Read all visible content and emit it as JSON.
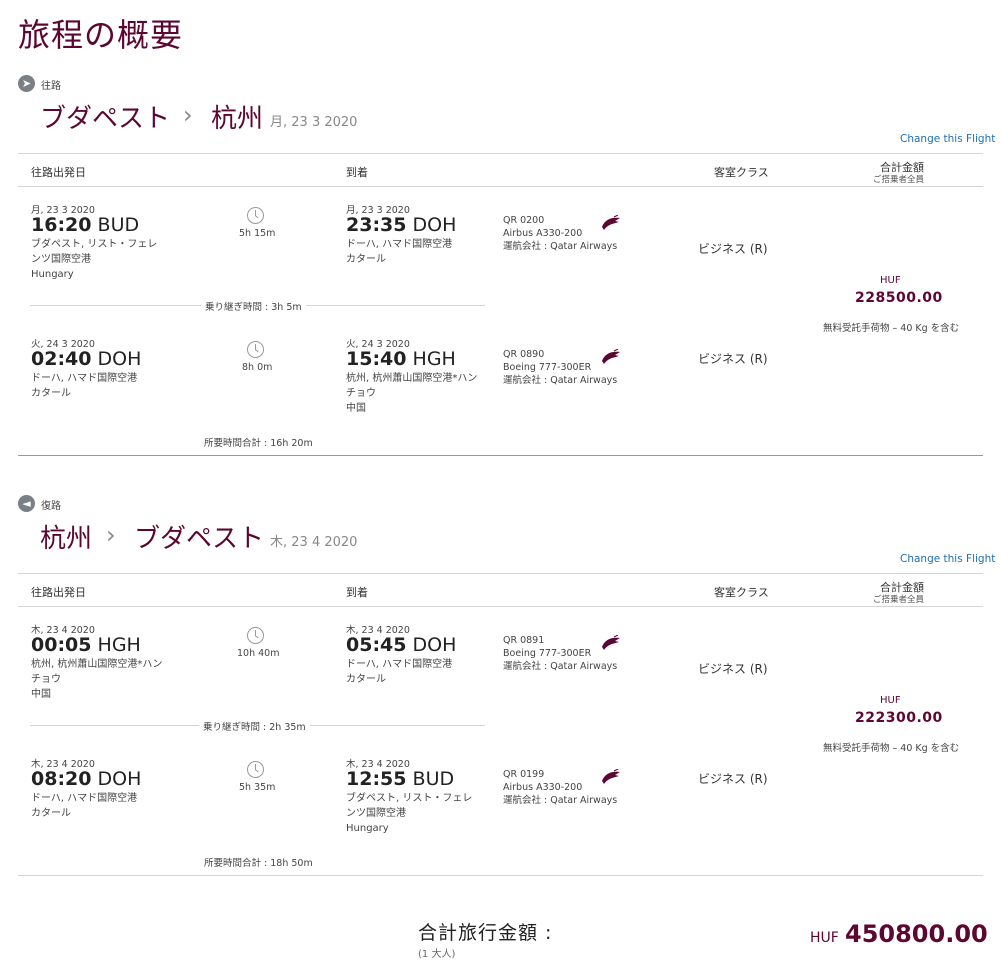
{
  "page_title": "旅程の概要",
  "headers": {
    "departure": "往路出発日",
    "arrival": "到着",
    "cabin": "客室クラス",
    "total": "合計金額",
    "total_sub": "ご搭乗者全員"
  },
  "change_link": "Change this Flight",
  "outbound": {
    "dir_label": "往路",
    "from": "ブダペスト",
    "to": "杭州",
    "date": "月, 23 3 2020",
    "segments": [
      {
        "dep_date": "月, 23 3 2020",
        "dep_time": "16:20",
        "dep_code": "BUD",
        "dep_airport_1": "ブダペスト, リスト・フェレ",
        "dep_airport_2": "ンツ国際空港",
        "dep_country": "Hungary",
        "duration": "5h 15m",
        "arr_date": "月, 23 3 2020",
        "arr_time": "23:35",
        "arr_code": "DOH",
        "arr_airport_1": "ドーハ, ハマド国際空港",
        "arr_airport_2": "カタール",
        "arr_country": "",
        "flight_no": "QR 0200",
        "aircraft": "Airbus A330-200",
        "operator": "運航会社 : Qatar Airways",
        "cabin": "ビジネス (R)"
      },
      {
        "dep_date": "火, 24 3 2020",
        "dep_time": "02:40",
        "dep_code": "DOH",
        "dep_airport_1": "ドーハ, ハマド国際空港",
        "dep_airport_2": "カタール",
        "dep_country": "",
        "duration": "8h 0m",
        "arr_date": "火, 24 3 2020",
        "arr_time": "15:40",
        "arr_code": "HGH",
        "arr_airport_1": "杭州, 杭州蕭山国際空港*ハン",
        "arr_airport_2": "チョウ",
        "arr_country": "中国",
        "flight_no": "QR 0890",
        "aircraft": "Boeing 777-300ER",
        "operator": "運航会社 : Qatar Airways",
        "cabin": "ビジネス (R)"
      }
    ],
    "layover": "乗り継ぎ時間 : 3h 5m",
    "total_time": "所要時間合計 : 16h 20m",
    "currency": "HUF",
    "price": "228500.00",
    "baggage": "無料受託手荷物 – 40 Kg を含む"
  },
  "inbound": {
    "dir_label": "復路",
    "from": "杭州",
    "to": "ブダペスト",
    "date": "木, 23 4 2020",
    "segments": [
      {
        "dep_date": "木, 23 4 2020",
        "dep_time": "00:05",
        "dep_code": "HGH",
        "dep_airport_1": "杭州, 杭州蕭山国際空港*ハン",
        "dep_airport_2": "チョウ",
        "dep_country": "中国",
        "duration": "10h 40m",
        "arr_date": "木, 23 4 2020",
        "arr_time": "05:45",
        "arr_code": "DOH",
        "arr_airport_1": "ドーハ, ハマド国際空港",
        "arr_airport_2": "カタール",
        "arr_country": "",
        "flight_no": "QR 0891",
        "aircraft": "Boeing 777-300ER",
        "operator": "運航会社 : Qatar Airways",
        "cabin": "ビジネス (R)"
      },
      {
        "dep_date": "木, 23 4 2020",
        "dep_time": "08:20",
        "dep_code": "DOH",
        "dep_airport_1": "ドーハ, ハマド国際空港",
        "dep_airport_2": "カタール",
        "dep_country": "",
        "duration": "5h 35m",
        "arr_date": "木, 23 4 2020",
        "arr_time": "12:55",
        "arr_code": "BUD",
        "arr_airport_1": "ブダペスト, リスト・フェレ",
        "arr_airport_2": "ンツ国際空港",
        "arr_country": "Hungary",
        "flight_no": "QR 0199",
        "aircraft": "Airbus A330-200",
        "operator": "運航会社 : Qatar Airways",
        "cabin": "ビジネス (R)"
      }
    ],
    "layover": "乗り継ぎ時間 : 2h 35m",
    "total_time": "所要時間合計 : 18h 50m",
    "currency": "HUF",
    "price": "222300.00",
    "baggage": "無料受託手荷物 – 40 Kg を含む"
  },
  "grand_total": {
    "label": "合計旅行金額 :",
    "sub": "(1 大人)",
    "currency": "HUF",
    "value": "450800.00"
  },
  "colors": {
    "brand": "#5c0632",
    "link": "#1f6fb5"
  },
  "icons": {
    "outbound": "plane-right-icon",
    "inbound": "plane-left-icon",
    "duration": "clock-icon",
    "airline": "qatar-oryx-logo"
  }
}
